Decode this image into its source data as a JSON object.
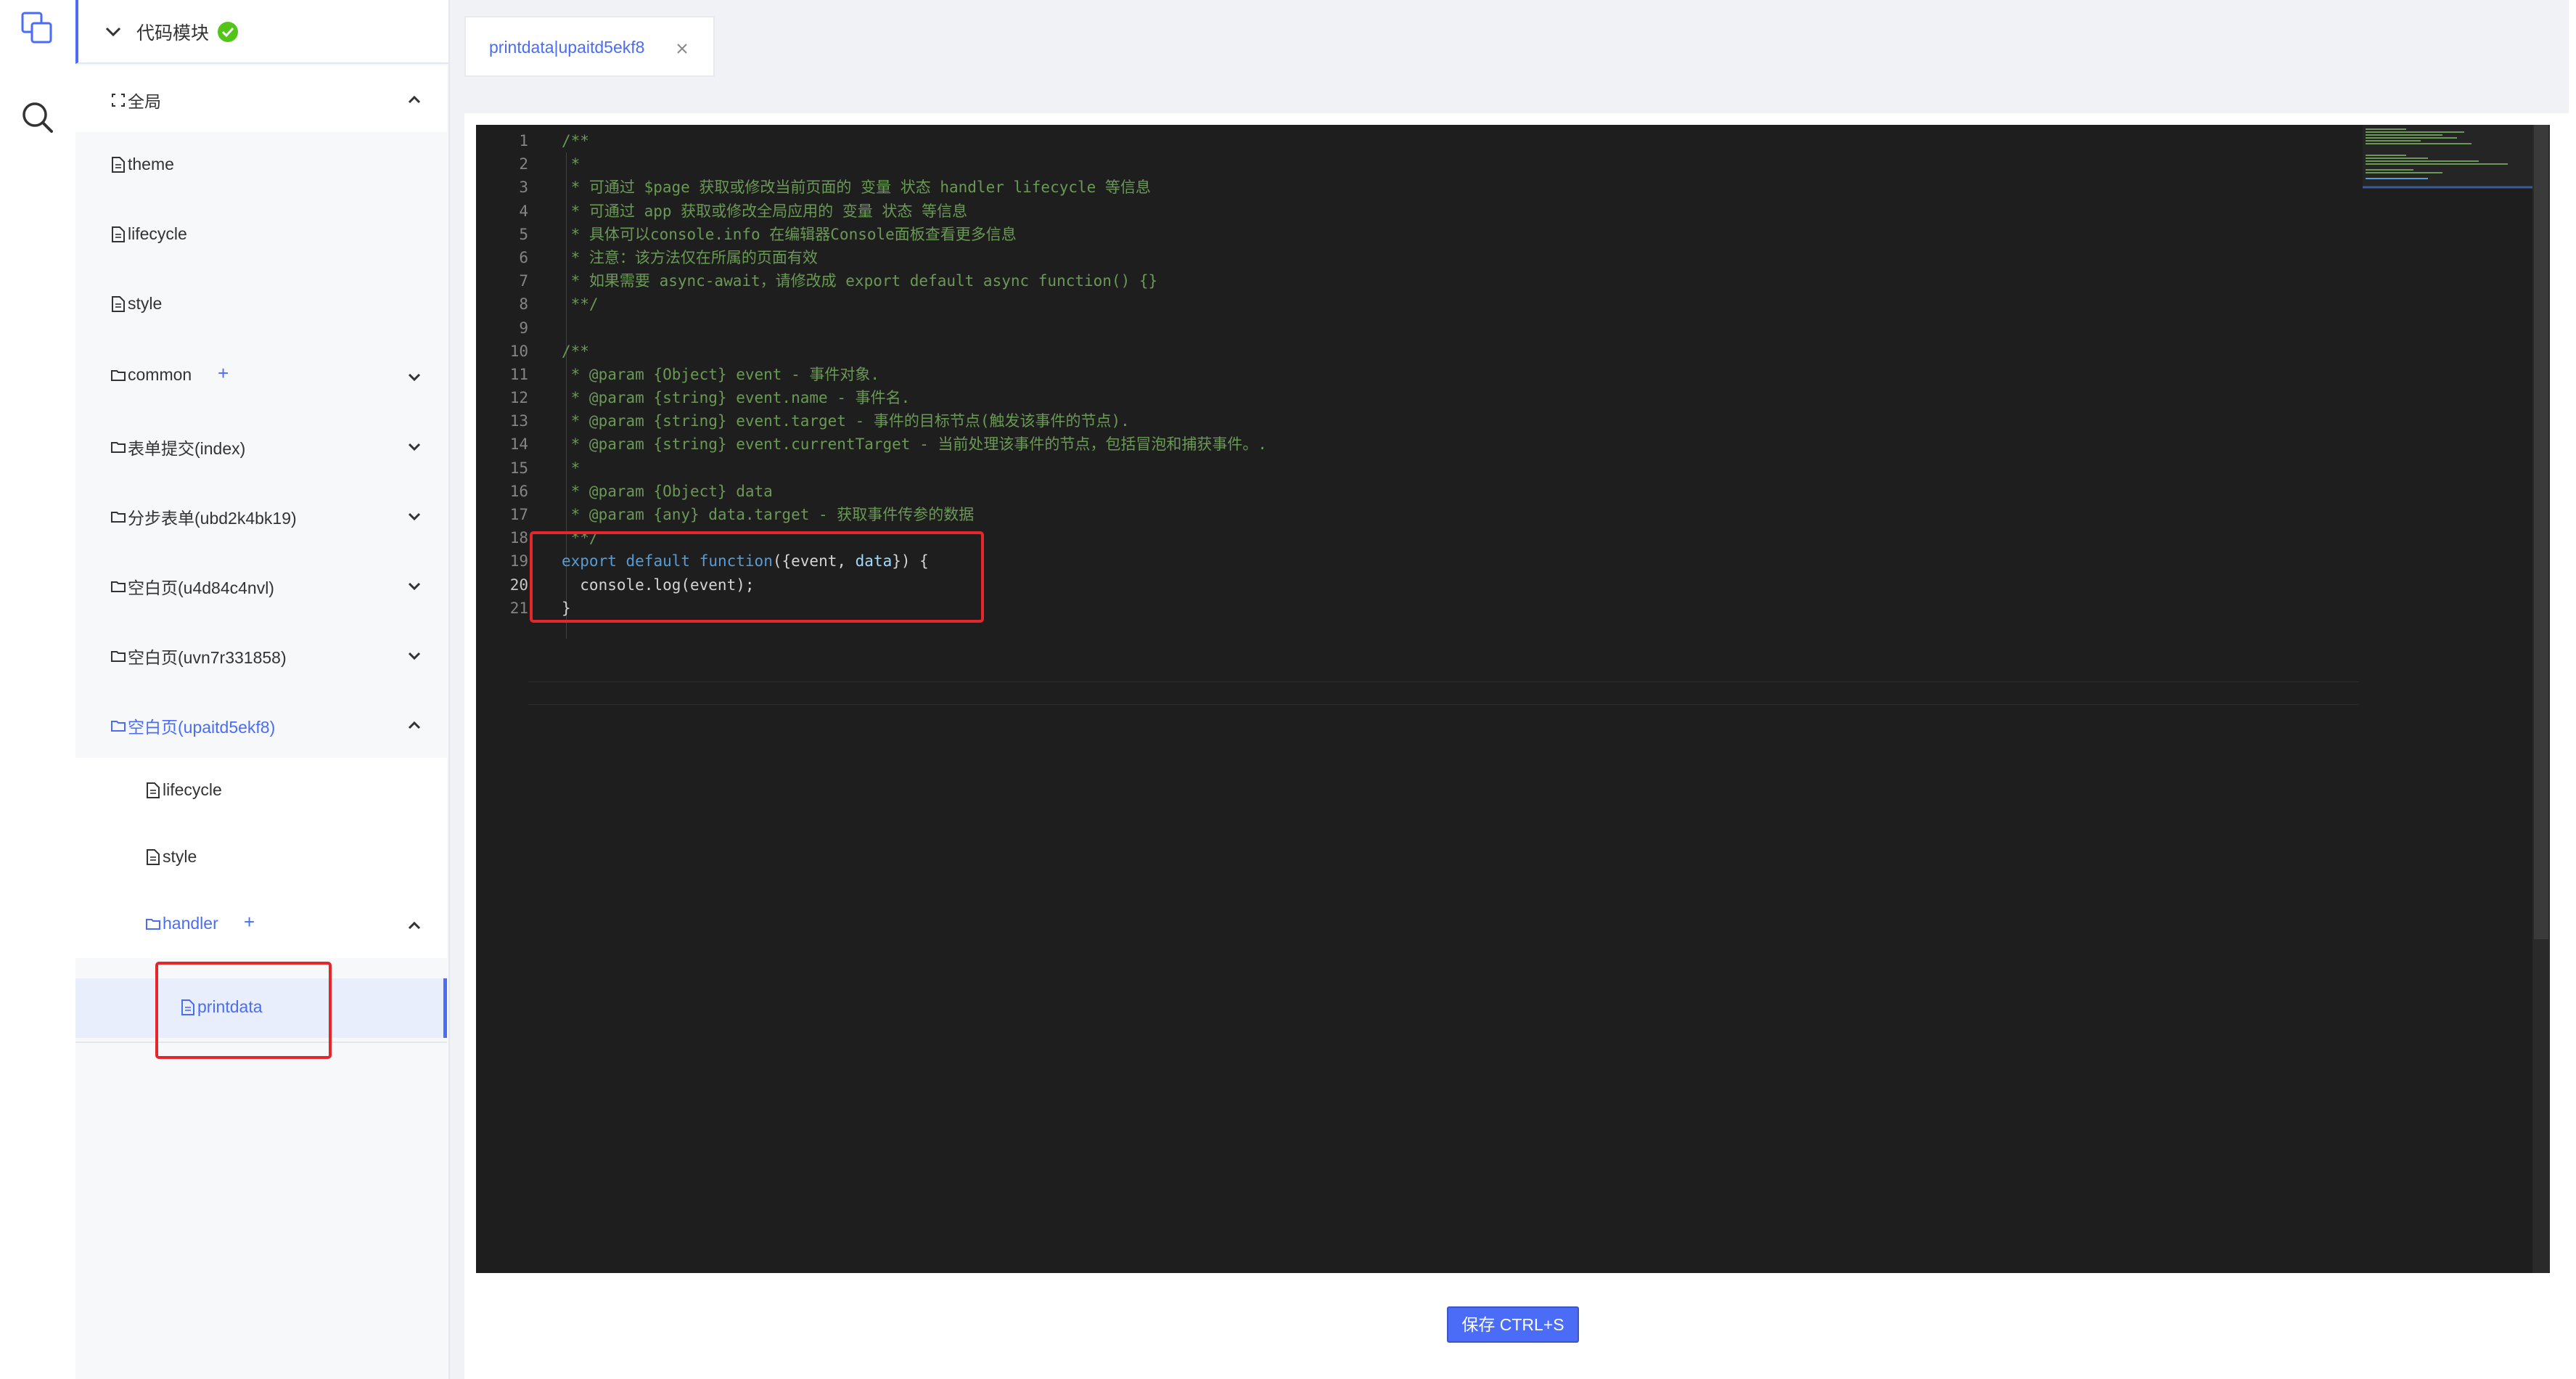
{
  "app": {
    "accent": "#4a6cf7",
    "highlight": "#e5262a"
  },
  "rail": {
    "icons": [
      "copy-icon",
      "search-icon"
    ]
  },
  "tree": {
    "header": {
      "title": "代码模块",
      "status": "check-circle-icon"
    },
    "items": [
      {
        "label": "全局",
        "icon": "fullscreen-icon",
        "arrow": "up"
      },
      {
        "label": "theme",
        "icon": "file-icon"
      },
      {
        "label": "lifecycle",
        "icon": "file-icon"
      },
      {
        "label": "style",
        "icon": "file-icon"
      },
      {
        "label": "common",
        "icon": "folder-icon",
        "plus": "+",
        "arrow": "down"
      },
      {
        "label": "表单提交(index)",
        "icon": "folder-icon",
        "arrow": "down"
      },
      {
        "label": "分步表单(ubd2k4bk19)",
        "icon": "folder-icon",
        "arrow": "down"
      },
      {
        "label": "空白页(u4d84c4nvl)",
        "icon": "folder-icon",
        "arrow": "down"
      },
      {
        "label": "空白页(uvn7r331858)",
        "icon": "folder-icon",
        "arrow": "down"
      },
      {
        "label": "空白页(upaitd5ekf8)",
        "icon": "folder-icon",
        "arrow": "up",
        "active": true
      },
      {
        "label": "lifecycle",
        "icon": "file-icon"
      },
      {
        "label": "style",
        "icon": "file-icon"
      },
      {
        "label": "handler",
        "icon": "folder-icon",
        "plus": "+",
        "arrow": "up"
      },
      {
        "label": "printdata",
        "icon": "file-icon",
        "selected": true
      }
    ]
  },
  "tab": {
    "label": "printdata|upaitd5ekf8"
  },
  "editor": {
    "current_line": 20,
    "line_numbers": [
      "1",
      "2",
      "3",
      "4",
      "5",
      "6",
      "7",
      "8",
      "9",
      "10",
      "11",
      "12",
      "13",
      "14",
      "15",
      "16",
      "17",
      "18",
      "19",
      "20",
      "21"
    ],
    "lines": [
      "/**",
      " *",
      " * 可通过 $page 获取或修改当前页面的 变量 状态 handler lifecycle 等信息",
      " * 可通过 app 获取或修改全局应用的 变量 状态 等信息",
      " * 具体可以console.info 在编辑器Console面板查看更多信息",
      " * 注意：该方法仅在所属的页面有效",
      " * 如果需要 async-await，请修改成 export default async function() {}",
      " **/",
      "",
      "/**",
      " * @param {Object} event - 事件对象.",
      " * @param {string} event.name - 事件名.",
      " * @param {string} event.target - 事件的目标节点(触发该事件的节点).",
      " * @param {string} event.currentTarget - 当前处理该事件的节点，包括冒泡和捕获事件。.",
      " *",
      " * @param {Object} data",
      " * @param {any} data.target - 获取事件传参的数据",
      " **/"
    ],
    "code19": {
      "kw1": "export",
      "kw2": "default",
      "fn": "function",
      "open": "({",
      "p1": "event",
      "sep": ", ",
      "p2": "data",
      "close": "}) {"
    },
    "code20": "  console.log(event);",
    "code21": "}"
  },
  "save_button": {
    "label": "保存 CTRL+S"
  }
}
